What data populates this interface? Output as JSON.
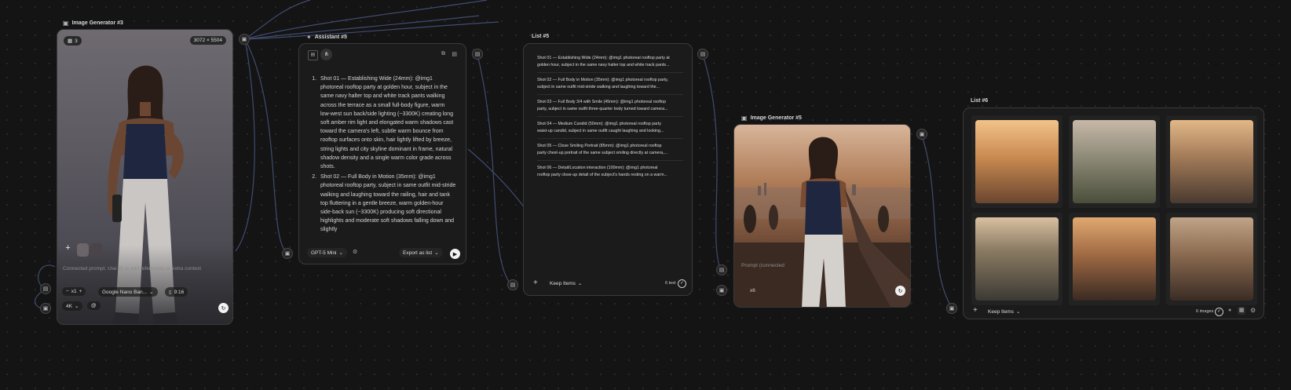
{
  "nodes": {
    "image_generator_3": {
      "title": "Image Generator #3",
      "count_badge": "3",
      "resolution": "3072 × 5504",
      "prompt_placeholder": "Connected prompt. Use @ to add references or extra context",
      "quantity": "x1",
      "model": "Google Nano Ban...",
      "aspect": "9:16",
      "quality": "4K"
    },
    "assistant_5": {
      "title": "Assistant #5",
      "items": [
        "Shot 01 — Establishing Wide (24mm): @img1 photoreal rooftop party at golden hour, subject in the same navy halter top and white track pants walking across the terrace as a small full-body figure, warm low-west sun back/side lighting (~3300K) creating long soft amber rim light and elongated warm shadows cast toward the camera's left, subtle warm bounce from rooftop surfaces onto skin, hair lightly lifted by breeze, string lights and city skyline dominant in frame, natural shadow density and a single warm color grade across shots.",
        "Shot 02 — Full Body in Motion (35mm): @img1 photoreal rooftop party, subject in same outfit mid-stride walking and laughing toward the railing, hair and tank top fluttering in a gentle breeze, warm golden-hour side-back sun (~3300K) producing soft directional highlights and moderate soft shadows falling down and slightly"
      ],
      "model": "GPT-5 Mini",
      "export_label": "Export as list"
    },
    "list_5": {
      "title": "List #5",
      "shots": [
        [
          "Shot 01 — Establishing Wide (24mm): @img1 photoreal rooftop party at",
          "golden hour, subject in the same navy halter top and white track pants..."
        ],
        [
          "Shot 02 — Full Body in Motion (35mm): @img1 photoreal rooftop party,",
          "subject in same outfit mid-stride walking and laughing toward the..."
        ],
        [
          "Shot 03 — Full Body 3/4 with Smile (45mm): @img1 photoreal rooftop",
          "party, subject in same outfit three-quarter body turned toward camera..."
        ],
        [
          "Shot 04 — Medium Candid (50mm): @img1 photoreal rooftop party",
          "waist-up candid, subject in same outfit caught laughing and looking..."
        ],
        [
          "Shot 05 — Close Smiling Portrait (85mm): @img1 photoreal rooftop",
          "party chest-up portrait of the same subject smiling directly at camera,..."
        ],
        [
          "Shot 06 — Detail/Location interaction (100mm): @img1 photoreal",
          "rooftop party close-up detail of the subject's hands resting on a warm..."
        ]
      ],
      "keep_label": "Keep Items",
      "count_label": "6 text"
    },
    "image_generator_5": {
      "title": "Image Generator #5",
      "prompt_placeholder": "Prompt (connected",
      "quantity": "x6"
    },
    "list_6": {
      "title": "List #6",
      "keep_label": "Keep Items",
      "count_label": "6 images"
    }
  },
  "colors": {
    "background": "#141414",
    "panel": "#1b1b1b",
    "wire": "#4a5580",
    "accent_white": "#f2f2f2"
  }
}
